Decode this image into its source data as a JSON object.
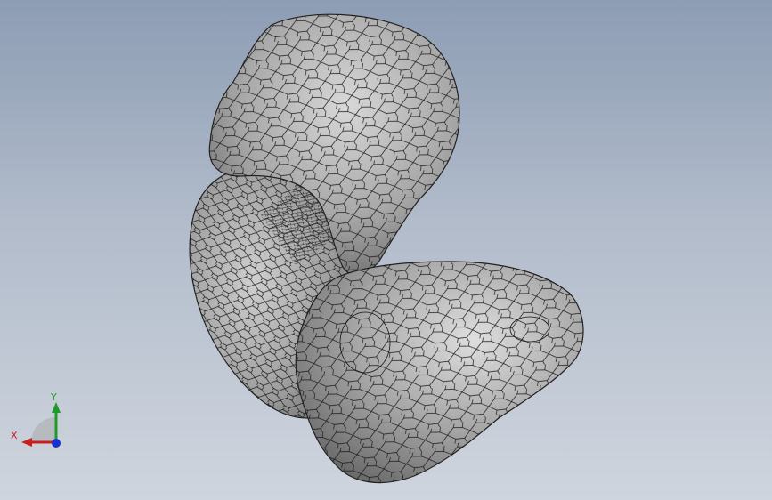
{
  "viewport": {
    "background_top": "#8d9db4",
    "background_bottom": "#cfd5de"
  },
  "model": {
    "shading_color": "#9a9a9a",
    "highlight_color": "#d4d4d4",
    "mesh_line_color": "#161616",
    "display_mode": "shaded-with-edges"
  },
  "triad": {
    "x_label": "X",
    "y_label": "Y",
    "x_color": "#c81e1e",
    "y_color": "#1f9a2a",
    "z_color": "#1a2fd0"
  }
}
